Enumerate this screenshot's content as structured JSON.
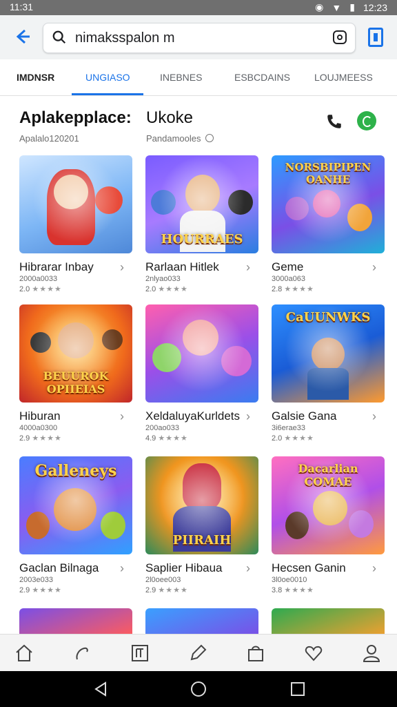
{
  "status_bar": {
    "time": "11:31",
    "right_time": "12:23",
    "icons": [
      "alarm-icon",
      "wifi-icon",
      "battery-icon"
    ]
  },
  "search": {
    "query": "nimaksspalon m",
    "icons": [
      "back-arrow-icon",
      "search-icon",
      "lens-icon",
      "profile-icon"
    ]
  },
  "tabs": [
    "IMDNSR",
    "UNGIASO",
    "INEBNES",
    "ESBCDAINS",
    "LOUJMEESS"
  ],
  "section": {
    "title_left": "Aplakepplace:",
    "title_right": "Ukoke",
    "sub_left": "Apalalo120201",
    "sub_right": "Pandamooles"
  },
  "cards": [
    {
      "name": "Hibrarar Inbay",
      "meta": "2000a0033",
      "rating": "2.0",
      "banner": ""
    },
    {
      "name": "Rarlaan Hitlek",
      "meta": "2nlyao033",
      "rating": "2.0",
      "banner": "HOURRAES"
    },
    {
      "name": "Geme",
      "meta": "3000a063",
      "rating": "2.8",
      "banner": "NORSBIPIPEN OANHE"
    },
    {
      "name": "Hiburan",
      "meta": "4000a0300",
      "rating": "2.9",
      "banner": "BEUUROK OPIIEIAS"
    },
    {
      "name": "XeldaluyaKurldets",
      "meta": "200ao033",
      "rating": "4.9",
      "banner": ""
    },
    {
      "name": "Galsie Gana",
      "meta": "3i6erae33",
      "rating": "2.0",
      "banner": "CaUUNWKS"
    },
    {
      "name": "Gaclan Bilnaga",
      "meta": "2003e033",
      "rating": "2.9",
      "banner": "Galleneys"
    },
    {
      "name": "Saplier Hibaua",
      "meta": "2l0oee003",
      "rating": "2.9",
      "banner": "PIIRAIH"
    },
    {
      "name": "Hecsen Ganin",
      "meta": "3l0oe0010",
      "rating": "3.8",
      "banner": "Dacarlian COMAE"
    }
  ],
  "bottom_nav": [
    "home-icon",
    "search-icon",
    "apps-icon",
    "edit-icon",
    "bag-icon",
    "heart-icon",
    "account-icon"
  ],
  "colors": {
    "accent": "#1a73e8",
    "green": "#2eb24a"
  }
}
